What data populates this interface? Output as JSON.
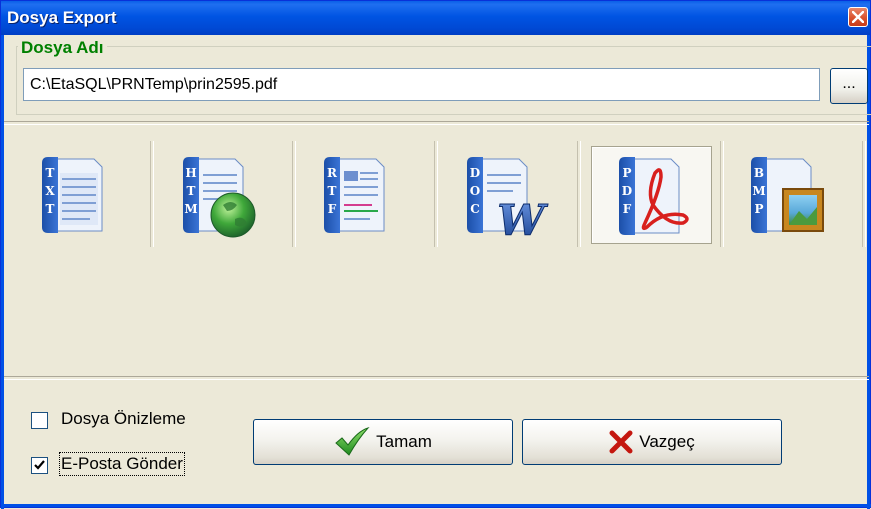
{
  "window": {
    "title": "Dosya Export"
  },
  "file_group": {
    "legend": "Dosya Adı",
    "path_value": "C:\\EtaSQL\\PRNTemp\\prin2595.pdf",
    "browse_label": "..."
  },
  "formats": [
    {
      "id": "txt",
      "icon": "txt-file-icon",
      "letters": "TXT",
      "selected": false
    },
    {
      "id": "htm",
      "icon": "htm-file-icon",
      "letters": "HTM",
      "selected": false
    },
    {
      "id": "rtf",
      "icon": "rtf-file-icon",
      "letters": "RTF",
      "selected": false
    },
    {
      "id": "doc",
      "icon": "doc-file-icon",
      "letters": "DOC",
      "selected": false
    },
    {
      "id": "pdf",
      "icon": "pdf-file-icon",
      "letters": "PDF",
      "selected": true
    },
    {
      "id": "bmp",
      "icon": "bmp-file-icon",
      "letters": "BMP",
      "selected": false
    }
  ],
  "options": {
    "preview": {
      "label": "Dosya Önizleme",
      "checked": false
    },
    "email": {
      "label": "E-Posta Gönder",
      "checked": true
    }
  },
  "buttons": {
    "ok": {
      "label": "Tamam",
      "icon": "checkmark-icon"
    },
    "cancel": {
      "label": "Vazgeç",
      "icon": "x-mark-icon"
    }
  },
  "colors": {
    "titlebar": "#0054e3",
    "legend": "#008000",
    "face": "#ece9d8",
    "acrobat_red": "#d8201e"
  }
}
